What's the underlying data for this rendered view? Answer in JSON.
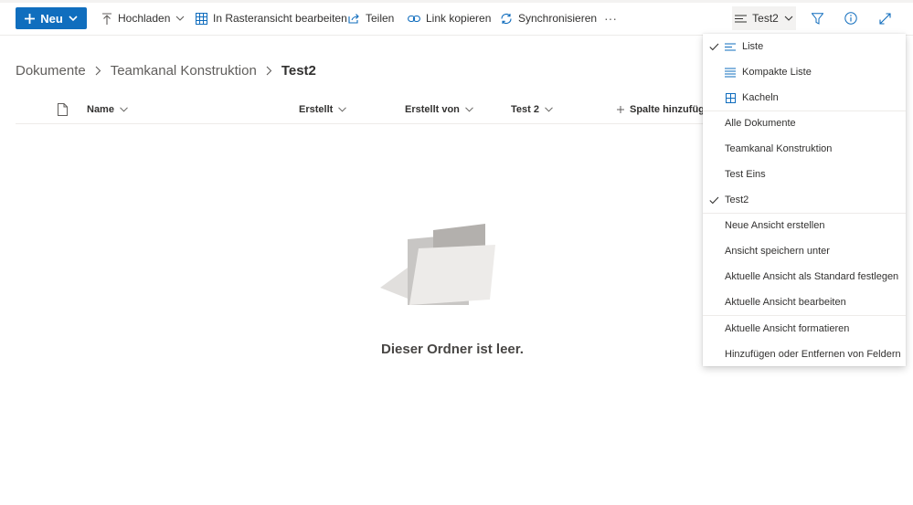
{
  "toolbar": {
    "new_label": "Neu",
    "upload_label": "Hochladen",
    "grid_edit_label": "In Rasteransicht bearbeiten",
    "share_label": "Teilen",
    "copy_link_label": "Link kopieren",
    "sync_label": "Synchronisieren",
    "more_label": "···",
    "view_label": "Test2"
  },
  "breadcrumb": {
    "items": [
      "Dokumente",
      "Teamkanal Konstruktion"
    ],
    "current": "Test2"
  },
  "columns": {
    "name": "Name",
    "created": "Erstellt",
    "created_by": "Erstellt von",
    "test2": "Test 2",
    "add": "Spalte hinzufüge"
  },
  "empty": {
    "message": "Dieser Ordner ist leer."
  },
  "view_menu": {
    "layouts": [
      {
        "label": "Liste",
        "checked": true,
        "icon": "list-icon"
      },
      {
        "label": "Kompakte Liste",
        "checked": false,
        "icon": "compact-list-icon"
      },
      {
        "label": "Kacheln",
        "checked": false,
        "icon": "tiles-icon"
      }
    ],
    "views": [
      {
        "label": "Alle Dokumente",
        "checked": false
      },
      {
        "label": "Teamkanal Konstruktion",
        "checked": false
      },
      {
        "label": "Test Eins",
        "checked": false
      },
      {
        "label": "Test2",
        "checked": true
      }
    ],
    "actions": [
      "Neue Ansicht erstellen",
      "Ansicht speichern unter",
      "Aktuelle Ansicht als Standard festlegen",
      "Aktuelle Ansicht bearbeiten"
    ],
    "format": [
      "Aktuelle Ansicht formatieren",
      "Hinzufügen oder Entfernen von Feldern"
    ]
  },
  "colors": {
    "accent": "#106ebe",
    "text": "#323130",
    "divider": "#edebe9"
  }
}
